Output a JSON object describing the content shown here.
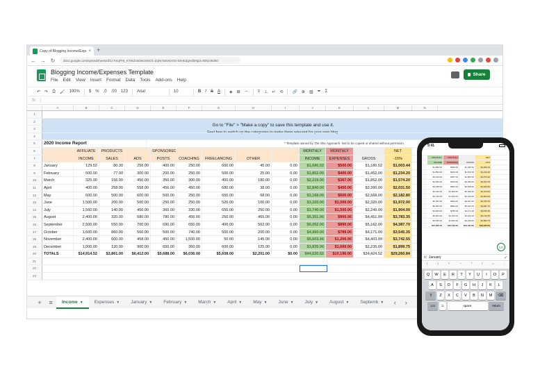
{
  "browser": {
    "tab_title": "Copy of Blogging Income/Expe...",
    "tab_close": "×",
    "new_tab": "+",
    "url": "docs.google.com/spreadsheets/d/1c7mqPHI_KT5CkIuD5CMSO1-Zq/NYaKWzr0S-83HEdg/edit#gid=905246350"
  },
  "sheet": {
    "title": "Blogging Income/Expenses Template",
    "menu": [
      "File",
      "Edit",
      "View",
      "Insert",
      "Format",
      "Data",
      "Tools",
      "Add-ons",
      "Help"
    ],
    "share_label": "Share",
    "toolbar": {
      "zoom": "100%",
      "currency": "$",
      "percent": "%",
      "dec1": ".0",
      "dec2": ".00",
      "format": "123",
      "font": "Arial",
      "size": "10",
      "bold": "B",
      "italic": "I",
      "strike": "S",
      "textcolor": "A"
    },
    "formula_prefix": "fx",
    "columns": [
      "A",
      "B",
      "C",
      "D",
      "E",
      "F",
      "G",
      "H",
      "I",
      "J",
      "K",
      "L",
      "M",
      "N"
    ],
    "banner_line1": "Go to \"File\" > \"Make a copy\" to save this template and use it.",
    "banner_line2": "Feel free to switch up the categories to make them relevant for your own blog.",
    "report_title": "2020 Income Report",
    "report_note": "* Template owned by The She Approach. Not to be copied or shared without permision.",
    "header_top": [
      "",
      "AFFILIATE",
      "PRODUCTS",
      "",
      "SPONSORED",
      "",
      "",
      "",
      "",
      "MONTHLY",
      "MONTHLY",
      "",
      "NET"
    ],
    "header_bottom": [
      "",
      "INCOME",
      "SALES",
      "ADS",
      "POSTS",
      "COACHING",
      "FREELANCING",
      "OTHER",
      "",
      "INCOME",
      "EXPENSES",
      "GROSS",
      "-15%"
    ],
    "months": [
      [
        "January",
        "129.52",
        "80.30",
        "256.00",
        "400.00",
        "250.00",
        "600.00",
        "45.00",
        "0.00",
        "$1,680.52",
        "$500.00",
        "$1,180.52",
        "$1,003.44"
      ],
      [
        "February",
        "500.00",
        "77.00",
        "300.00",
        "200.00",
        "250.00",
        "500.00",
        "25.00",
        "0.00",
        "$1,852.00",
        "$400.00",
        "$1,452.00",
        "$1,234.20"
      ],
      [
        "March",
        "325.00",
        "156.00",
        "450.00",
        "350.00",
        "300.00",
        "450.00",
        "180.00",
        "0.00",
        "$2,219.00",
        "$367.00",
        "$1,852.00",
        "$1,574.20"
      ],
      [
        "April",
        "400.00",
        "258.00",
        "558.00",
        "456.00",
        "450.00",
        "680.00",
        "38.00",
        "0.00",
        "$2,840.00",
        "$450.00",
        "$2,390.00",
        "$2,031.50"
      ],
      [
        "May",
        "600.00",
        "500.00",
        "600.00",
        "500.00",
        "250.00",
        "650.00",
        "68.00",
        "0.00",
        "$3,168.00",
        "$600.00",
        "$2,568.00",
        "$2,182.80"
      ],
      [
        "June",
        "1,500.00",
        "200.00",
        "500.00",
        "250.00",
        "250.00",
        "520.00",
        "100.00",
        "0.00",
        "$3,320.00",
        "$1,000.00",
        "$2,320.00",
        "$1,972.00"
      ],
      [
        "July",
        "1,560.00",
        "140.00",
        "450.00",
        "360.00",
        "330.00",
        "650.00",
        "250.00",
        "0.00",
        "$3,740.00",
        "$1,500.00",
        "$2,240.00",
        "$1,904.00"
      ],
      [
        "August",
        "2,400.00",
        "320.00",
        "680.00",
        "780.00",
        "456.00",
        "250.00",
        "465.00",
        "0.00",
        "$5,351.00",
        "$900.00",
        "$4,451.00",
        "$3,783.35"
      ],
      [
        "September",
        "2,500.00",
        "550.00",
        "700.00",
        "690.00",
        "650.00",
        "400.00",
        "562.00",
        "0.00",
        "$6,052.00",
        "$890.00",
        "$5,162.00",
        "$4,387.70"
      ],
      [
        "October",
        "1,600.00",
        "860.00",
        "560.00",
        "500.00",
        "740.00",
        "500.00",
        "200.00",
        "0.00",
        "$4,960.00",
        "$789.00",
        "$4,171.00",
        "$3,545.35"
      ],
      [
        "November",
        "2,400.00",
        "600.00",
        "458.00",
        "450.00",
        "1,500.00",
        "50.00",
        "145.00",
        "0.00",
        "$5,603.00",
        "$1,200.00",
        "$4,403.00",
        "$3,742.55"
      ],
      [
        "December",
        "1,000.00",
        "120.00",
        "900.00",
        "650.00",
        "360.00",
        "600.00",
        "125.00",
        "0.00",
        "$3,835.00",
        "$1,600.00",
        "$2,235.00",
        "$1,899.75"
      ]
    ],
    "totals": [
      "TOTALS",
      "$14,914.52",
      "$3,861.00",
      "$6,412.00",
      "$5,688.00",
      "$6,036.00",
      "$5,608.00",
      "$2,201.00",
      "$0.00",
      "$44,620.52",
      "$10,196.00",
      "$34,424.52",
      "$29,260.84"
    ],
    "row_numbers": [
      "1",
      "2",
      "3",
      "4",
      "5",
      "6",
      "7",
      "8",
      "9",
      "10",
      "11",
      "12",
      "13",
      "14",
      "15",
      "16",
      "17",
      "18",
      "19",
      "20",
      "21",
      "22",
      "23"
    ],
    "tabs": [
      "Income",
      "Expenses",
      "January",
      "February",
      "March",
      "April",
      "May",
      "June",
      "July",
      "August",
      "Septemb"
    ]
  },
  "phone": {
    "time": "9:41",
    "fab": "123",
    "formula_value": "January",
    "kb_row1": [
      "Q",
      "W",
      "E",
      "R",
      "T",
      "Y",
      "U",
      "I",
      "O",
      "P"
    ],
    "kb_row2": [
      "A",
      "S",
      "D",
      "F",
      "G",
      "H",
      "J",
      "K",
      "L"
    ],
    "kb_row3": [
      "Z",
      "X",
      "C",
      "V",
      "B",
      "N",
      "M"
    ],
    "kb_num": "123",
    "kb_space": "space",
    "kb_return": "return",
    "grid_head1": [
      "MONTHLY",
      "MONTHLY",
      "",
      "NET"
    ],
    "grid_head2": [
      "INCOME",
      "EXPENSES",
      "GROSS",
      "-15%"
    ],
    "grid_rows": [
      [
        "$1,680.52",
        "$500.00",
        "$1,180.52",
        "$1,003.44"
      ],
      [
        "$1,852.00",
        "$400.00",
        "$1,452.00",
        "$1,234.20"
      ],
      [
        "$2,219.00",
        "$367.00",
        "$1,852.00",
        "$1,574.20"
      ],
      [
        "$2,840.00",
        "$450.00",
        "$2,390.00",
        "$2,031.50"
      ],
      [
        "$3,168.00",
        "$600.00",
        "$2,568.00",
        "$2,182.80"
      ],
      [
        "$3,320.00",
        "$1,000.00",
        "$2,320.00",
        "$1,972.00"
      ],
      [
        "$3,740.00",
        "$1,500.00",
        "$2,240.00",
        "$1,904.00"
      ],
      [
        "$5,351.00",
        "$900.00",
        "$4,451.00",
        "$3,783.35"
      ],
      [
        "$6,052.00",
        "$890.00",
        "$5,162.00",
        "$4,387.70"
      ],
      [
        "$4,960.00",
        "$789.00",
        "$4,171.00",
        "$3,545.35"
      ],
      [
        "$5,603.00",
        "$1,200.00",
        "$4,403.00",
        "$3,742.55"
      ],
      [
        "$3,835.00",
        "$1,600.00",
        "$2,235.00",
        "$1,899.75"
      ],
      [
        "$44,620.52",
        "$10,196.00",
        "$34,424.52",
        "$29,260.84"
      ]
    ]
  },
  "colors": {
    "header_orange": "#fce5cd",
    "income_green": "#b6d7a8",
    "expense_red": "#ea9999",
    "gross_gray": "#efefef",
    "net_yellow": "#ffe599",
    "banner_blue": "#cfe2f3",
    "brand_green": "#188038"
  }
}
